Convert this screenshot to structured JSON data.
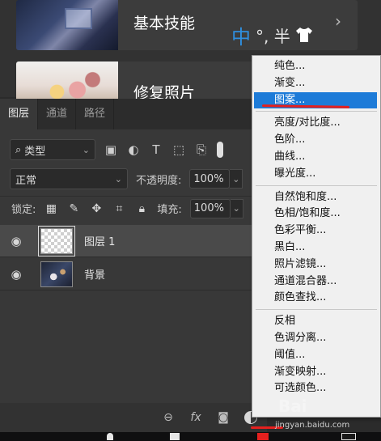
{
  "learn": {
    "cards": [
      {
        "title": "基本技能"
      },
      {
        "title": "修复照片"
      }
    ],
    "arrow": "›"
  },
  "ime": {
    "main": "中",
    "rest": "°, 半"
  },
  "panel": {
    "tabs": [
      "图层",
      "通道",
      "路径"
    ],
    "filter": {
      "kind": "类型"
    },
    "blend": {
      "mode": "正常",
      "opacity_label": "不透明度:",
      "opacity": "100%"
    },
    "lock": {
      "label": "锁定:",
      "fill_label": "填充:",
      "fill": "100%"
    },
    "layers": [
      {
        "name": "图层 1",
        "selected": true
      },
      {
        "name": "背景",
        "selected": false
      }
    ],
    "bottom": {
      "fx": "fx"
    }
  },
  "menu": {
    "groups": [
      [
        "纯色...",
        "渐变...",
        "图案..."
      ],
      [
        "亮度/对比度...",
        "色阶...",
        "曲线...",
        "曝光度..."
      ],
      [
        "自然饱和度...",
        "色相/饱和度...",
        "色彩平衡...",
        "黑白...",
        "照片滤镜...",
        "通道混合器...",
        "颜色查找..."
      ],
      [
        "反相",
        "色调分离...",
        "阈值...",
        "渐变映射...",
        "可选颜色..."
      ]
    ],
    "selected": "图案..."
  },
  "watermark": {
    "text": "jingyan.baidu.com",
    "logo": "Bai"
  },
  "colors": {
    "menu_highlight": "#1d7bd8",
    "annotation_red": "#e5201e",
    "ime_blue": "#2f8fe0"
  }
}
